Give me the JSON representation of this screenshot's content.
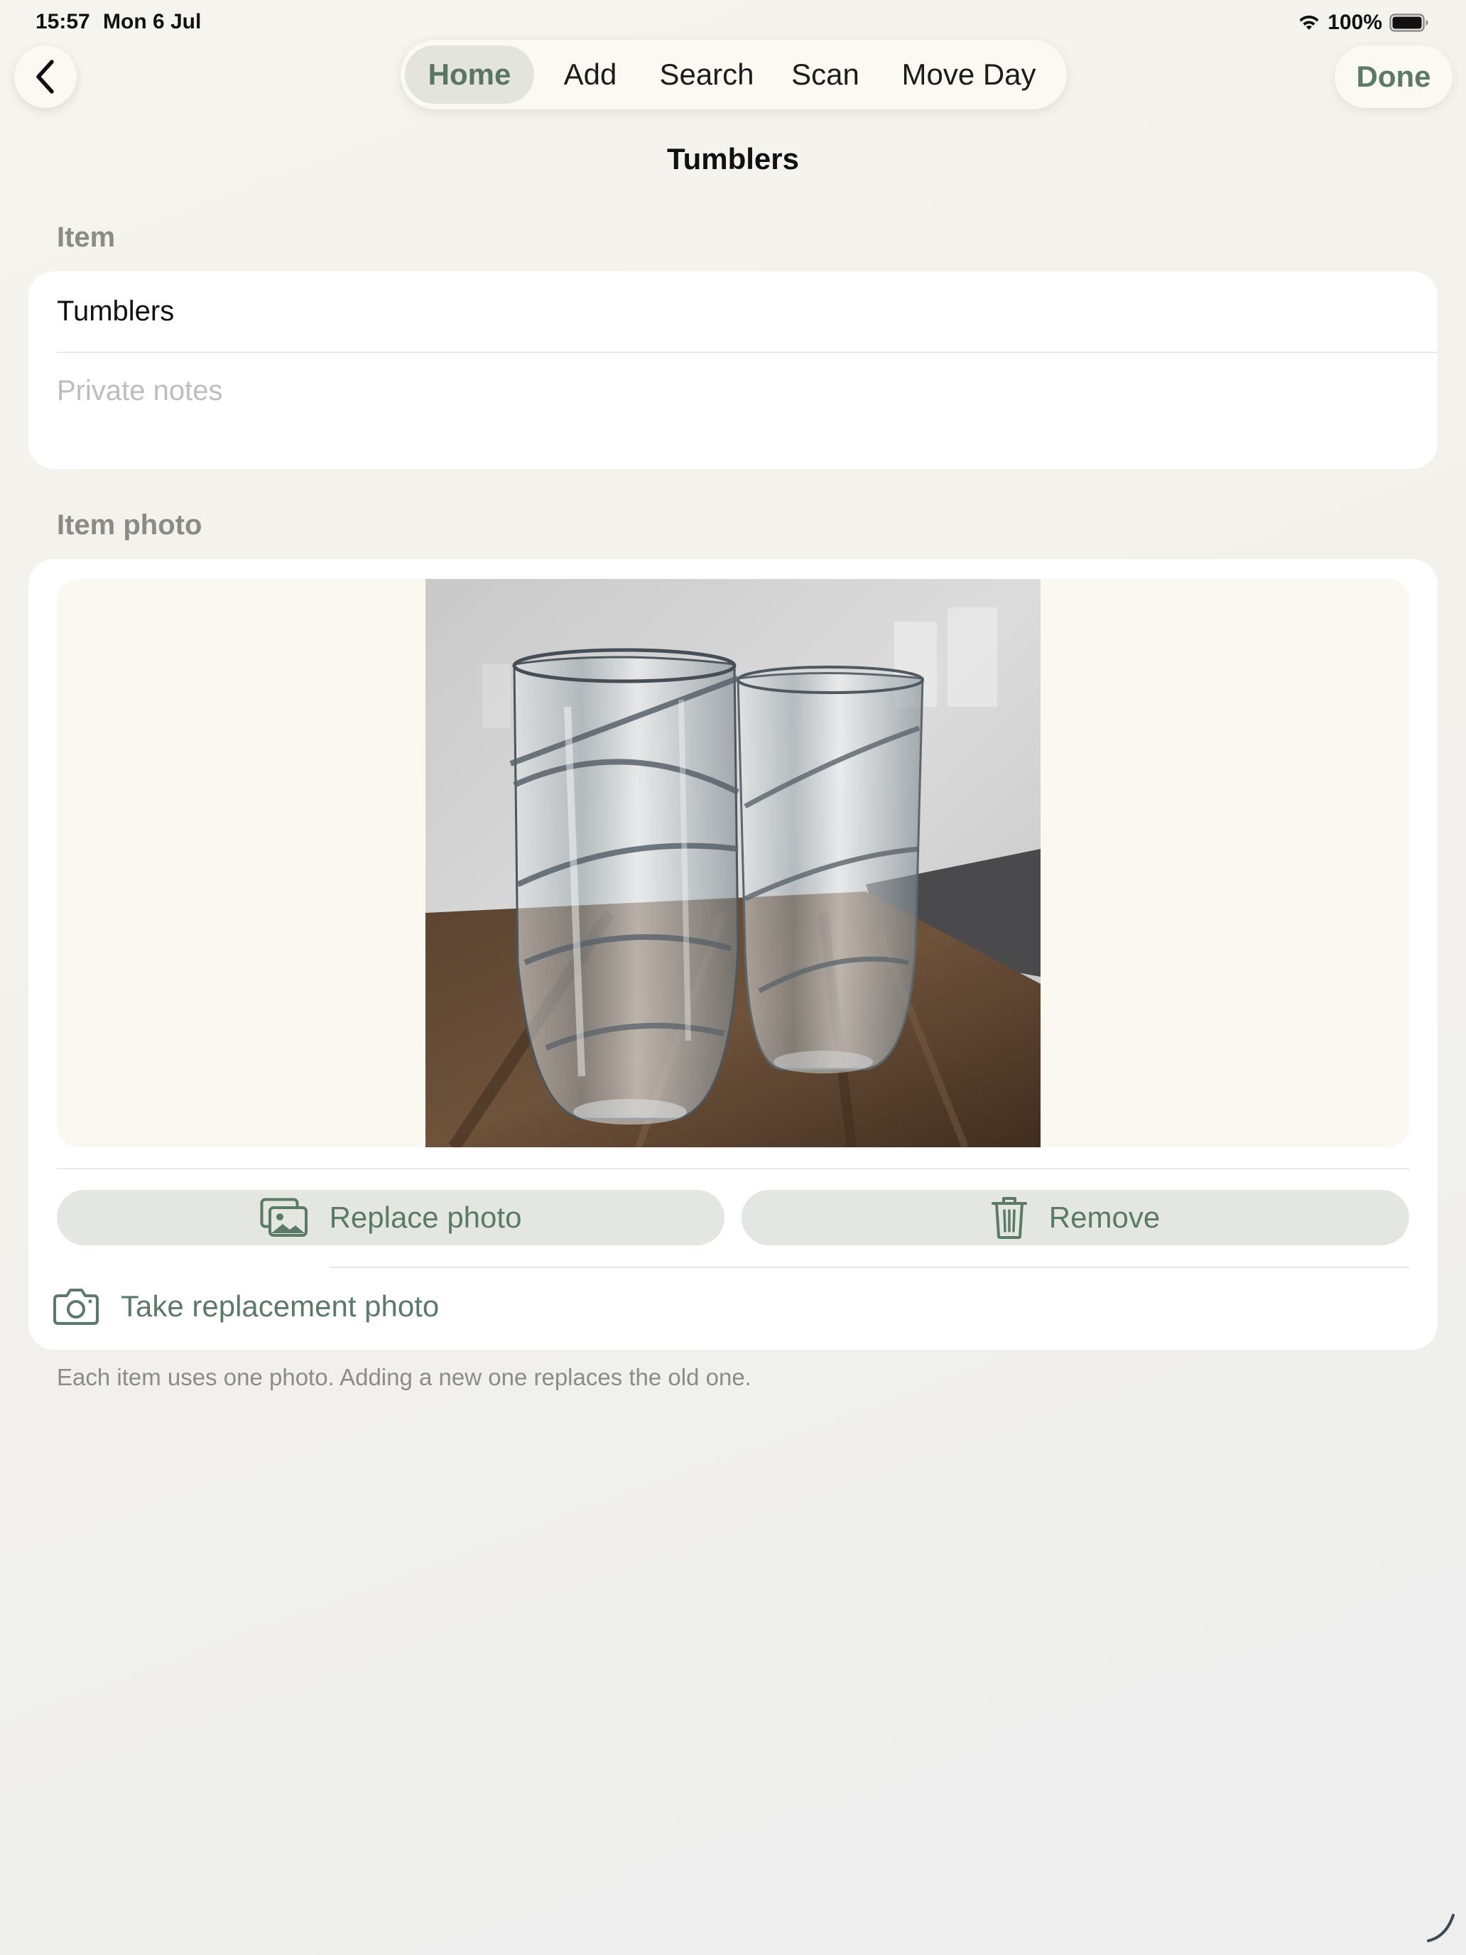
{
  "status_bar": {
    "time": "15:57",
    "date": "Mon 6 Jul",
    "battery_percent": "100%",
    "battery_level": 1.0,
    "wifi_icon": "wifi-icon",
    "battery_icon": "battery-icon"
  },
  "nav": {
    "back_icon": "chevron-left-icon",
    "tabs": [
      {
        "label": "Home",
        "active": true
      },
      {
        "label": "Add",
        "active": false
      },
      {
        "label": "Search",
        "active": false
      },
      {
        "label": "Scan",
        "active": false
      },
      {
        "label": "Move Day",
        "active": false
      }
    ],
    "done_label": "Done"
  },
  "page": {
    "title": "Tumblers"
  },
  "item_section": {
    "label": "Item",
    "name_value": "Tumblers",
    "notes_placeholder": "Private notes",
    "notes_value": ""
  },
  "photo_section": {
    "label": "Item photo",
    "photo_icon": "two-crystal-tumblers-photo",
    "replace_label": "Replace photo",
    "replace_icon": "photos-icon",
    "remove_label": "Remove",
    "remove_icon": "trash-icon",
    "take_label": "Take replacement photo",
    "take_icon": "camera-icon",
    "footnote": "Each item uses one photo. Adding a new one replaces the old one."
  },
  "colors": {
    "accent": "#5b7a68",
    "background": "#f4f2ed",
    "card": "#ffffff",
    "button_fill": "#e3e6e1"
  }
}
